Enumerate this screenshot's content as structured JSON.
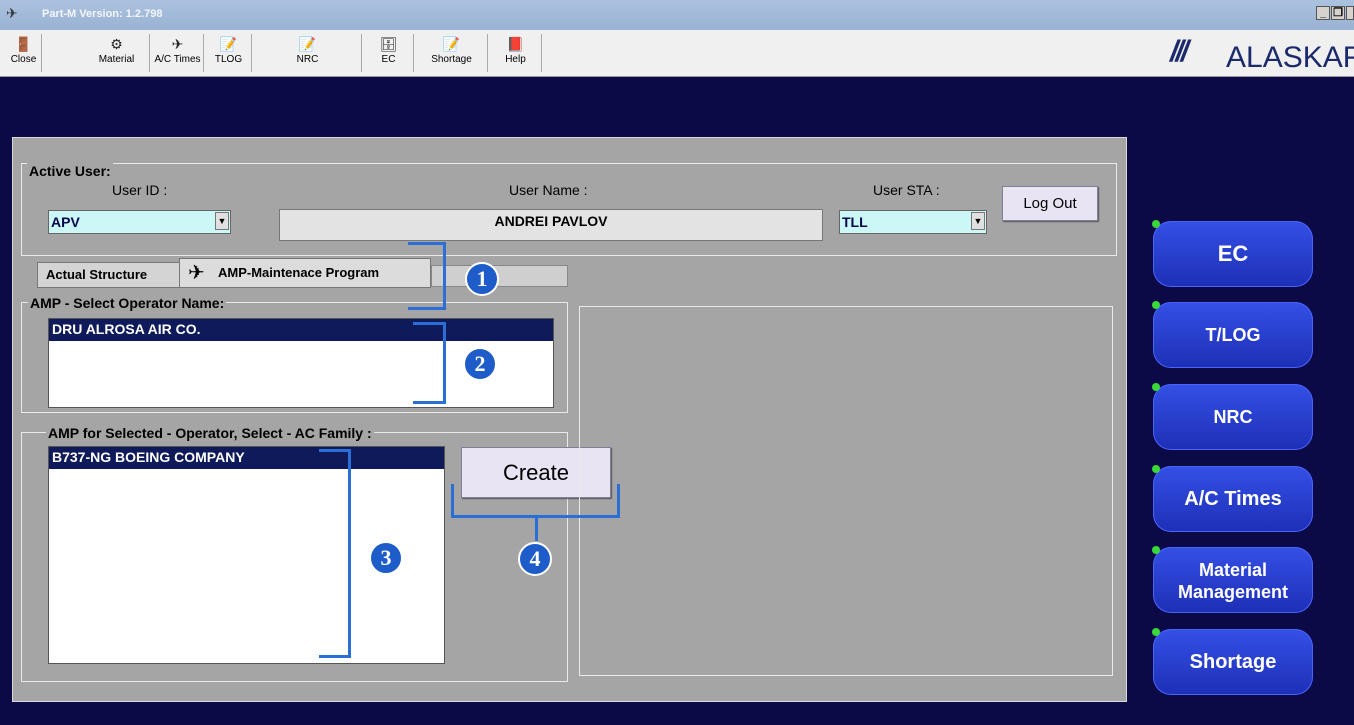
{
  "window": {
    "title": "Part-M  Version: 1.2.798"
  },
  "toolbar": {
    "items": [
      {
        "label": "Close",
        "icon": "close-icon"
      },
      {
        "label": "Material",
        "icon": "material-icon"
      },
      {
        "label": "A/C Times",
        "icon": "aircraft-icon"
      },
      {
        "label": "TLOG",
        "icon": "tlog-icon"
      },
      {
        "label": "NRC",
        "icon": "nrc-icon"
      },
      {
        "label": "EC",
        "icon": "ec-icon"
      },
      {
        "label": "Shortage",
        "icon": "shortage-icon"
      },
      {
        "label": "Help",
        "icon": "help-icon"
      }
    ]
  },
  "logo": {
    "text": "ALASKAF"
  },
  "active_user": {
    "legend": "Active User:",
    "user_id_label": "User ID :",
    "user_id_value": "APV",
    "user_name_label": "User Name :",
    "user_name_value": "ANDREI PAVLOV",
    "user_sta_label": "User STA :",
    "user_sta_value": "TLL",
    "logout_label": "Log Out"
  },
  "tabs": {
    "actual_structure": "Actual Structure",
    "amp_program": "AMP-Maintenace Program"
  },
  "operator": {
    "legend": "AMP - Select Operator Name:",
    "items": [
      "DRU   ALROSA AIR CO."
    ]
  },
  "ac_family": {
    "legend": "AMP for Selected - Operator, Select - AC Family :",
    "items": [
      "B737-NG  BOEING COMPANY"
    ]
  },
  "create_label": "Create",
  "annotations": [
    "1",
    "2",
    "3",
    "4"
  ],
  "nav": {
    "ec": "EC",
    "tlog": "T/LOG",
    "nrc": "NRC",
    "ac_times": "A/C Times",
    "material_1": "Material",
    "material_2": "Management",
    "shortage": "Shortage"
  },
  "colors": {
    "background": "#0b0a46",
    "nav_button": "#2a3ed6",
    "selection": "#0f1a5a",
    "annotation": "#1d5cc9",
    "combo": "#ccf7f7"
  }
}
